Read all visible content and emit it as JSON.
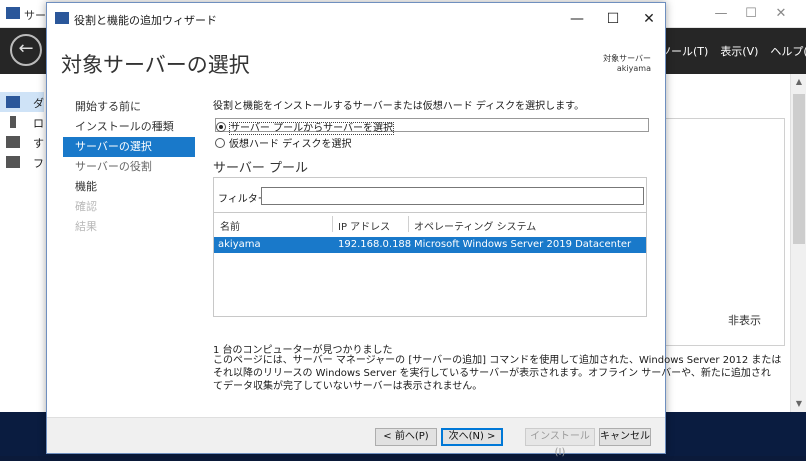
{
  "background": {
    "title": "サー",
    "window_controls": [
      "—",
      "☐",
      "✕"
    ],
    "menus": [
      "ツール(T)",
      "表示(V)",
      "ヘルプ(H)"
    ],
    "sidebar_items": [
      "ダ",
      "ロ",
      "す",
      "フ"
    ],
    "hide_label": "非表示"
  },
  "wizard": {
    "title": "役割と機能の追加ウィザード",
    "controls": {
      "minimize": "—",
      "maximize": "☐",
      "close": "✕"
    },
    "heading": "対象サーバーの選択",
    "target_server_label": "対象サーバー",
    "target_server_value": "akiyama",
    "nav": [
      {
        "label": "開始する前に",
        "state": "normal"
      },
      {
        "label": "インストールの種類",
        "state": "normal"
      },
      {
        "label": "サーバーの選択",
        "state": "active"
      },
      {
        "label": "サーバーの役割",
        "state": "sub"
      },
      {
        "label": "機能",
        "state": "normal"
      },
      {
        "label": "確認",
        "state": "disabled"
      },
      {
        "label": "結果",
        "state": "disabled"
      }
    ],
    "intro": "役割と機能をインストールするサーバーまたは仮想ハード ディスクを選択します。",
    "radio_pool": "サーバー プールからサーバーを選択",
    "radio_vhd": "仮想ハード ディスクを選択",
    "pool_title": "サーバー プール",
    "filter_label": "フィルター:",
    "filter_value": "",
    "columns": {
      "name": "名前",
      "ip": "IP アドレス",
      "os": "オペレーティング システム"
    },
    "rows": [
      {
        "name": "akiyama",
        "ip": "192.168.0.188",
        "os": "Microsoft Windows Server 2019 Datacenter"
      }
    ],
    "count_text": "1 台のコンピューターが見つかりました",
    "description_lines": [
      "このページには、サーバー マネージャーの [サーバーの追加] コマンドを使用して追加された、Windows Server 2012 または",
      "それ以降のリリースの Windows Server を実行しているサーバーが表示されます。オフライン サーバーや、新たに追加され",
      "てデータ収集が完了していないサーバーは表示されません。"
    ],
    "buttons": {
      "prev": "< 前へ(P)",
      "next": "次へ(N) >",
      "install": "インストール(I)",
      "cancel": "キャンセル"
    }
  },
  "colors": {
    "accent": "#1979ca",
    "toolbar_dark": "#262626",
    "taskbar": "#0a1c40"
  }
}
